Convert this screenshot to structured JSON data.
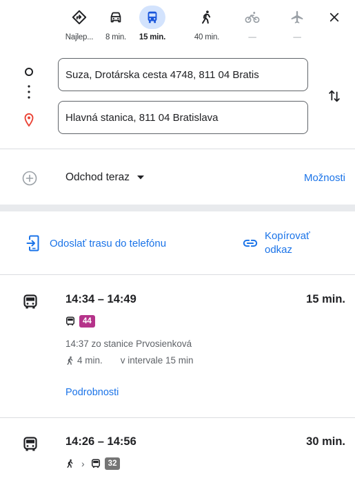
{
  "modes": [
    {
      "name": "best",
      "icon": "directions-diamond-icon",
      "label": "Najlep..."
    },
    {
      "name": "car",
      "icon": "car-icon",
      "label": "8 min."
    },
    {
      "name": "transit",
      "icon": "bus-icon",
      "label": "15 min."
    },
    {
      "name": "walk",
      "icon": "walking-icon",
      "label": "40 min."
    },
    {
      "name": "bike",
      "icon": "bicycle-icon",
      "label": "—"
    },
    {
      "name": "flight",
      "icon": "airplane-icon",
      "label": "—"
    }
  ],
  "origin": {
    "value": "Suza, Drotárska cesta 4748, 811 04 Bratis"
  },
  "destination": {
    "value": "Hlavná stanica, 811 04 Bratislava"
  },
  "departure": {
    "label": "Odchod teraz",
    "options_label": "Možnosti"
  },
  "share": {
    "send_label": "Odoslať trasu do telefónu",
    "copy_label_line1": "Kopírovať",
    "copy_label_line2": "odkaz"
  },
  "routes": [
    {
      "time": "14:34 – 14:49",
      "duration": "15 min.",
      "line": "44",
      "line_color": "#b5338a",
      "from": "14:37 zo stanice Prvosienková",
      "walk": "4 min.",
      "interval": "v intervale 15 min",
      "details_label": "Podrobnosti"
    },
    {
      "time": "14:26 – 14:56",
      "duration": "30 min.",
      "line": "32",
      "line_color": "#757575"
    }
  ],
  "colors": {
    "accent": "#1a73e8",
    "active_mode_bg": "#d3e3fd",
    "destination_pin": "#ea4335"
  }
}
